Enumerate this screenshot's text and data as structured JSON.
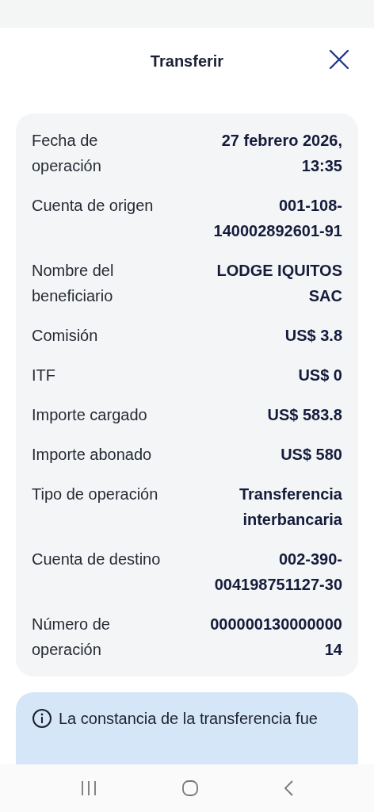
{
  "header": {
    "title": "Transferir"
  },
  "details": [
    {
      "label": "Fecha de\noperación",
      "value": "27 febrero 2026,\n13:35"
    },
    {
      "label": "Cuenta de origen",
      "value": "001-108-\n140002892601-91"
    },
    {
      "label": "Nombre del\nbeneficiario",
      "value": "LODGE IQUITOS\nSAC"
    },
    {
      "label": "Comisión",
      "value": "US$ 3.8"
    },
    {
      "label": "ITF",
      "value": "US$ 0"
    },
    {
      "label": "Importe cargado",
      "value": "US$ 583.8"
    },
    {
      "label": "Importe abonado",
      "value": "US$ 580"
    },
    {
      "label": "Tipo de operación",
      "value": "Transferencia\ninterbancaria"
    },
    {
      "label": "Cuenta de destino",
      "value": "002-390-\n004198751127-30"
    },
    {
      "label": "Número de\noperación",
      "value": "000000130000000\n14"
    }
  ],
  "info": {
    "text": "La constancia de la transferencia fue"
  }
}
